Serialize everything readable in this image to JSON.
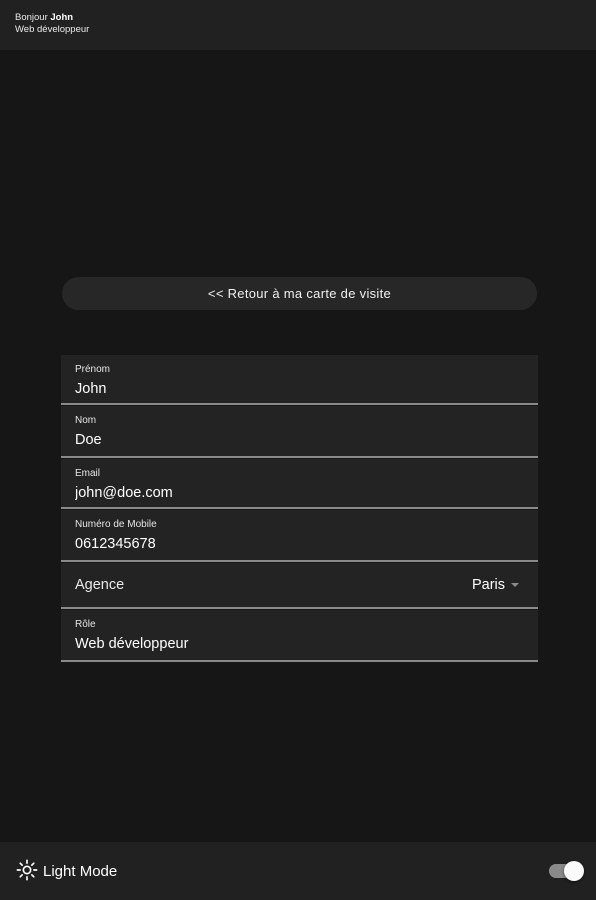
{
  "header": {
    "greeting_prefix": "Bonjour",
    "user_name": "John",
    "job_title": "Web développeur"
  },
  "back_button": {
    "label": "<< Retour à ma carte de visite"
  },
  "form": {
    "first_name": {
      "label": "Prénom",
      "value": "John"
    },
    "last_name": {
      "label": "Nom",
      "value": "Doe"
    },
    "email": {
      "label": "Email",
      "value": "john@doe.com"
    },
    "mobile": {
      "label": "Numéro de Mobile",
      "value": "0612345678"
    },
    "agency": {
      "label": "Agence",
      "value": "Paris"
    },
    "role": {
      "label": "Rôle",
      "value": "Web développeur"
    }
  },
  "footer": {
    "mode_label": "Light Mode",
    "mode_icon": "sun-icon",
    "toggle_on": true
  },
  "colors": {
    "background": "#161616",
    "bar": "#212121",
    "field": "#232323",
    "underline": "#8a8a8a"
  }
}
